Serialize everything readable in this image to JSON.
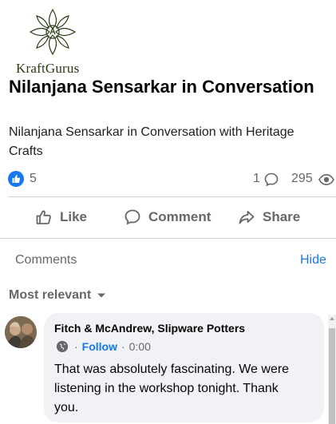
{
  "brand": {
    "logo_text": "KraftGurus"
  },
  "post": {
    "title": "Nilanjana Sensarkar in Conversation",
    "subtitle": "Nilanjana Sensarkar in Conversation with Heritage Crafts"
  },
  "stats": {
    "likes": "5",
    "comments": "1",
    "views": "295"
  },
  "actions": {
    "like": "Like",
    "comment": "Comment",
    "share": "Share"
  },
  "comments_section": {
    "label": "Comments",
    "hide_label": "Hide",
    "sort_label": "Most relevant"
  },
  "comment": {
    "author": "Fitch & McAndrew, Slipware Potters",
    "follow_label": "Follow",
    "separator": "·",
    "time": "0:00",
    "text": "That was absolutely fascinating. We were listening in the workshop tonight. Thank you."
  },
  "colors": {
    "accent": "#1877f2",
    "muted": "#65676b",
    "bubble": "#f0f2f5",
    "logo_green": "#2d3a18"
  }
}
